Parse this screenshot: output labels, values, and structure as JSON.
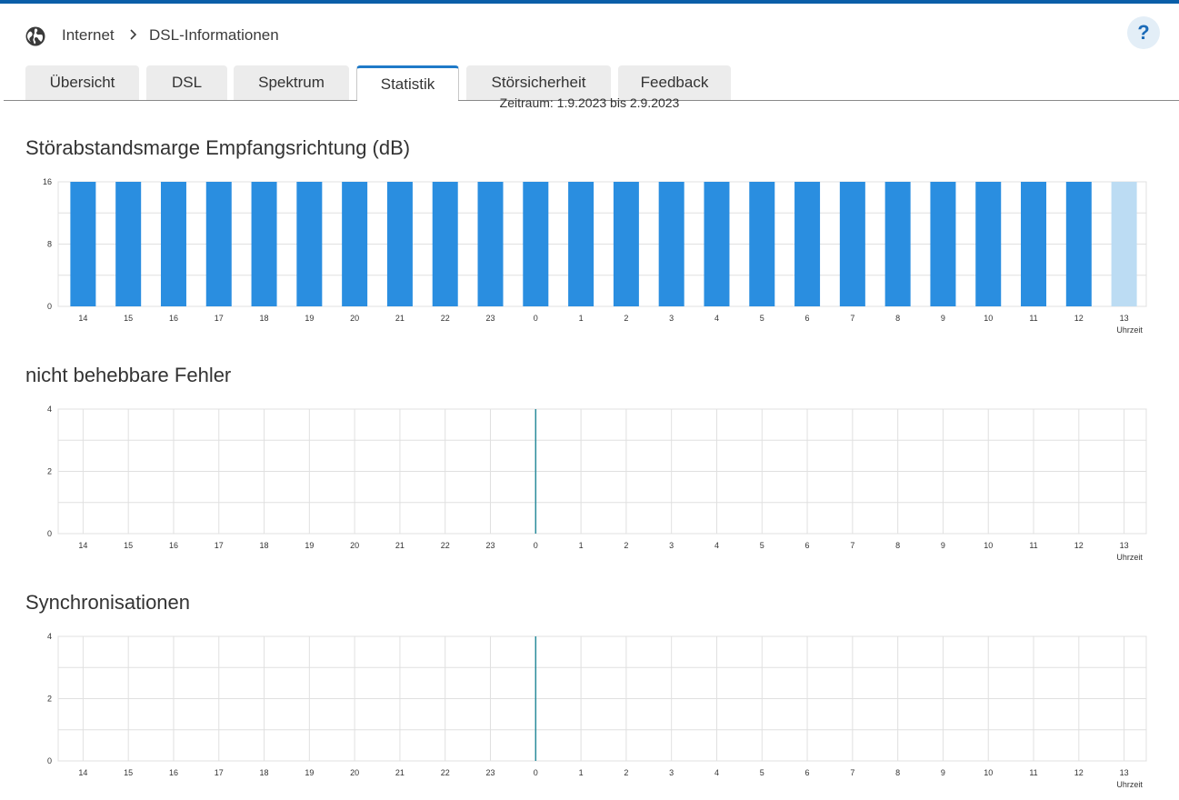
{
  "breadcrumb": {
    "icon": "globe-icon",
    "section": "Internet",
    "page": "DSL-Informationen"
  },
  "help": {
    "label": "?"
  },
  "tabs": [
    {
      "label": "Übersicht",
      "active": false
    },
    {
      "label": "DSL",
      "active": false
    },
    {
      "label": "Spektrum",
      "active": false
    },
    {
      "label": "Statistik",
      "active": true
    },
    {
      "label": "Störsicherheit",
      "active": false
    },
    {
      "label": "Feedback",
      "active": false
    }
  ],
  "period": "Zeitraum: 1.9.2023 bis 2.9.2023",
  "colors": {
    "accent": "#1f7ac8",
    "bar": "#2a8ee0",
    "bar_current": "#bcdcf3",
    "marker": "#2a8c9c",
    "grid": "#e0e0e0"
  },
  "chart_data": [
    {
      "type": "bar",
      "title": "Störabstandsmarge Empfangsrichtung (dB)",
      "xlabel": "Uhrzeit",
      "ylabel": "",
      "categories": [
        "14",
        "15",
        "16",
        "17",
        "18",
        "19",
        "20",
        "21",
        "22",
        "23",
        "0",
        "1",
        "2",
        "3",
        "4",
        "5",
        "6",
        "7",
        "8",
        "9",
        "10",
        "11",
        "12",
        "13"
      ],
      "values": [
        16,
        16,
        16,
        16,
        16,
        16,
        16,
        16,
        16,
        16,
        16,
        16,
        16,
        16,
        16,
        16,
        16,
        16,
        16,
        16,
        16,
        16,
        16,
        16
      ],
      "ylim": [
        0,
        16
      ],
      "yticks": [
        "0",
        "8",
        "16"
      ],
      "grid": true,
      "highlight_last": true
    },
    {
      "type": "bar",
      "title": "nicht behebbare Fehler",
      "xlabel": "Uhrzeit",
      "ylabel": "",
      "categories": [
        "14",
        "15",
        "16",
        "17",
        "18",
        "19",
        "20",
        "21",
        "22",
        "23",
        "0",
        "1",
        "2",
        "3",
        "4",
        "5",
        "6",
        "7",
        "8",
        "9",
        "10",
        "11",
        "12",
        "13"
      ],
      "values": [
        0,
        0,
        0,
        0,
        0,
        0,
        0,
        0,
        0,
        0,
        0,
        0,
        0,
        0,
        0,
        0,
        0,
        0,
        0,
        0,
        0,
        0,
        0,
        0
      ],
      "ylim": [
        0,
        4
      ],
      "yticks": [
        "0",
        "2",
        "4"
      ],
      "grid": true,
      "day_marker": "0"
    },
    {
      "type": "bar",
      "title": "Synchronisationen",
      "xlabel": "Uhrzeit",
      "ylabel": "",
      "categories": [
        "14",
        "15",
        "16",
        "17",
        "18",
        "19",
        "20",
        "21",
        "22",
        "23",
        "0",
        "1",
        "2",
        "3",
        "4",
        "5",
        "6",
        "7",
        "8",
        "9",
        "10",
        "11",
        "12",
        "13"
      ],
      "values": [
        0,
        0,
        0,
        0,
        0,
        0,
        0,
        0,
        0,
        0,
        0,
        0,
        0,
        0,
        0,
        0,
        0,
        0,
        0,
        0,
        0,
        0,
        0,
        0
      ],
      "ylim": [
        0,
        4
      ],
      "yticks": [
        "0",
        "2",
        "4"
      ],
      "grid": true,
      "day_marker": "0"
    }
  ]
}
